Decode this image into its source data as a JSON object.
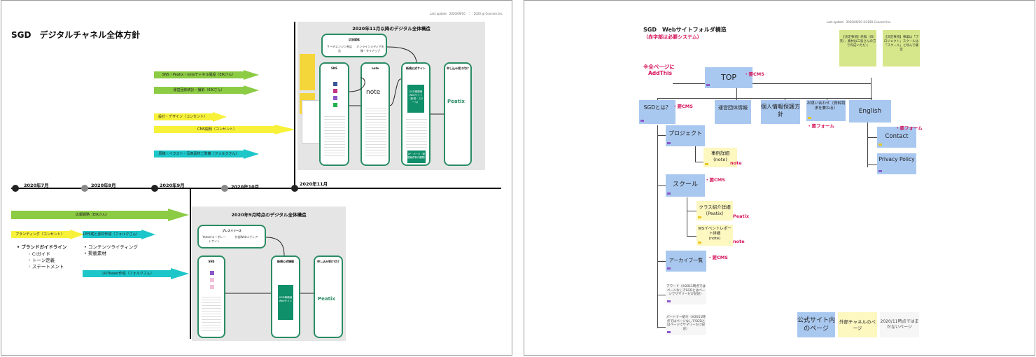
{
  "left": {
    "meta": "Last update：2020/09/10　｜　2020 @ Concens Inc.",
    "title": "SGD　デジタルチャネル全体方針",
    "arrows_top": [
      "SNS・Peatix・noteチャネル開設（EIKさん）",
      "運営団体統計・撮影（EIKさん）",
      "設計・デザイン（コンセント）",
      "CMS開発（コンセント）",
      "原稿・イラスト・写真素材ご準備（フォルクさん）"
    ],
    "arrows_bottom": [
      "広報戦略（EIKさん）",
      "ブランディング（コンセント）",
      "LP作成と素材作成（フォルクさん）",
      "LP/Teaser作成（フォルクさん）"
    ],
    "timeline": [
      "2020年7月",
      "2020年8月",
      "2020年9月",
      "2020年10月",
      "2020年11月"
    ],
    "bullets_a": {
      "head": "ブランドガイドライン",
      "items": [
        "CIガイド",
        "トーン定義",
        "ステートメント"
      ]
    },
    "bullets_b": [
      "コンテンツライティング",
      "掲載素材"
    ],
    "panel_nov": {
      "title": "2020年11月以降のデジタル全体構造",
      "ad_title": "広告媒体",
      "ad_items": [
        "サーチエンジン系広告",
        "オンラインメディア出稿・タイアップ"
      ],
      "sns": "SNS",
      "note_title": "note",
      "note_logo": "note",
      "site_title": "新規公式サイト",
      "site_center": "SGD事務局Webサイト（新規・スクール）",
      "site_bottom": "LP・ページ（新規案件等の展開）",
      "peatix_title": "申し込み受け付け",
      "peatix_logo": "Peatix"
    },
    "panel_sep": {
      "title": "2020年9月時点のデジタル全体構造",
      "press_title": "プレスリリース",
      "press_items": [
        "Yahoo!コーポレートサイト",
        "外部Webメディア"
      ],
      "sns": "SNS",
      "site_title": "新規公式情報",
      "site_center": "SGD事務局Webサイト",
      "peatix_title": "申し込み受け付け",
      "peatix_logo": "Peatix"
    }
  },
  "right": {
    "meta": "Last update：2020/09/10 ©2020 Concent Inc.",
    "title": "SGD　Webサイトフォルダ構造",
    "subtitle": "（赤字部は必要システム）",
    "top_note": [
      "※全ページに",
      "AddThis"
    ],
    "top": "TOP",
    "cms": "・要CMS",
    "level1": [
      "SGDとは？",
      "運営団体情報",
      "個人情報保護方針",
      "お問い合わせ（資料請求を兼ねる）",
      "English"
    ],
    "form": "・要フォーム",
    "english_children": [
      "Contact",
      "Privacy Policy"
    ],
    "project": "プロジェクト",
    "project_child": [
      "事例詳細",
      "(note)"
    ],
    "note_label": "note",
    "school": "スクール",
    "school_children": [
      [
        "クラス紹介詳細",
        "（Peatix）"
      ],
      [
        "WSイベントレポート詳細",
        "(note)"
      ]
    ],
    "peatix_label": "Peatix",
    "archive": "アーカイブ一覧",
    "award": "アワード（※2011時点ではページなしでSGDとはページでサマリーだけ記述）",
    "partner": "パートナー紹介（※2011時点ではページなしでSGDとはページでサマリーだけ記述）",
    "stickies": [
      "【決定事項】原稿（日/英）、素材は三島さんの方で作成いただく",
      "【決定事項】事業は「プロジェクト」スクールは「スクール」と呼んで確定"
    ],
    "legend": [
      "公式サイト内のページ",
      "外部チャネルのページ",
      "2020/11時点ではまだないページ"
    ]
  },
  "colors": {
    "green_arrow": "#8ccb44",
    "yellow_arrow": "#f7f13a",
    "cyan_arrow": "#1cc6c9",
    "card_border": "#2a8c64",
    "site_box": "#a9c8ef",
    "external_box": "#fdf7c0",
    "red_note": "#d4145a",
    "sticky": "#d6e68a"
  },
  "icons": [
    "facebook-icon",
    "instagram-icon",
    "twitter-icon",
    "line-icon",
    "peatix-logo",
    "note-logo"
  ]
}
